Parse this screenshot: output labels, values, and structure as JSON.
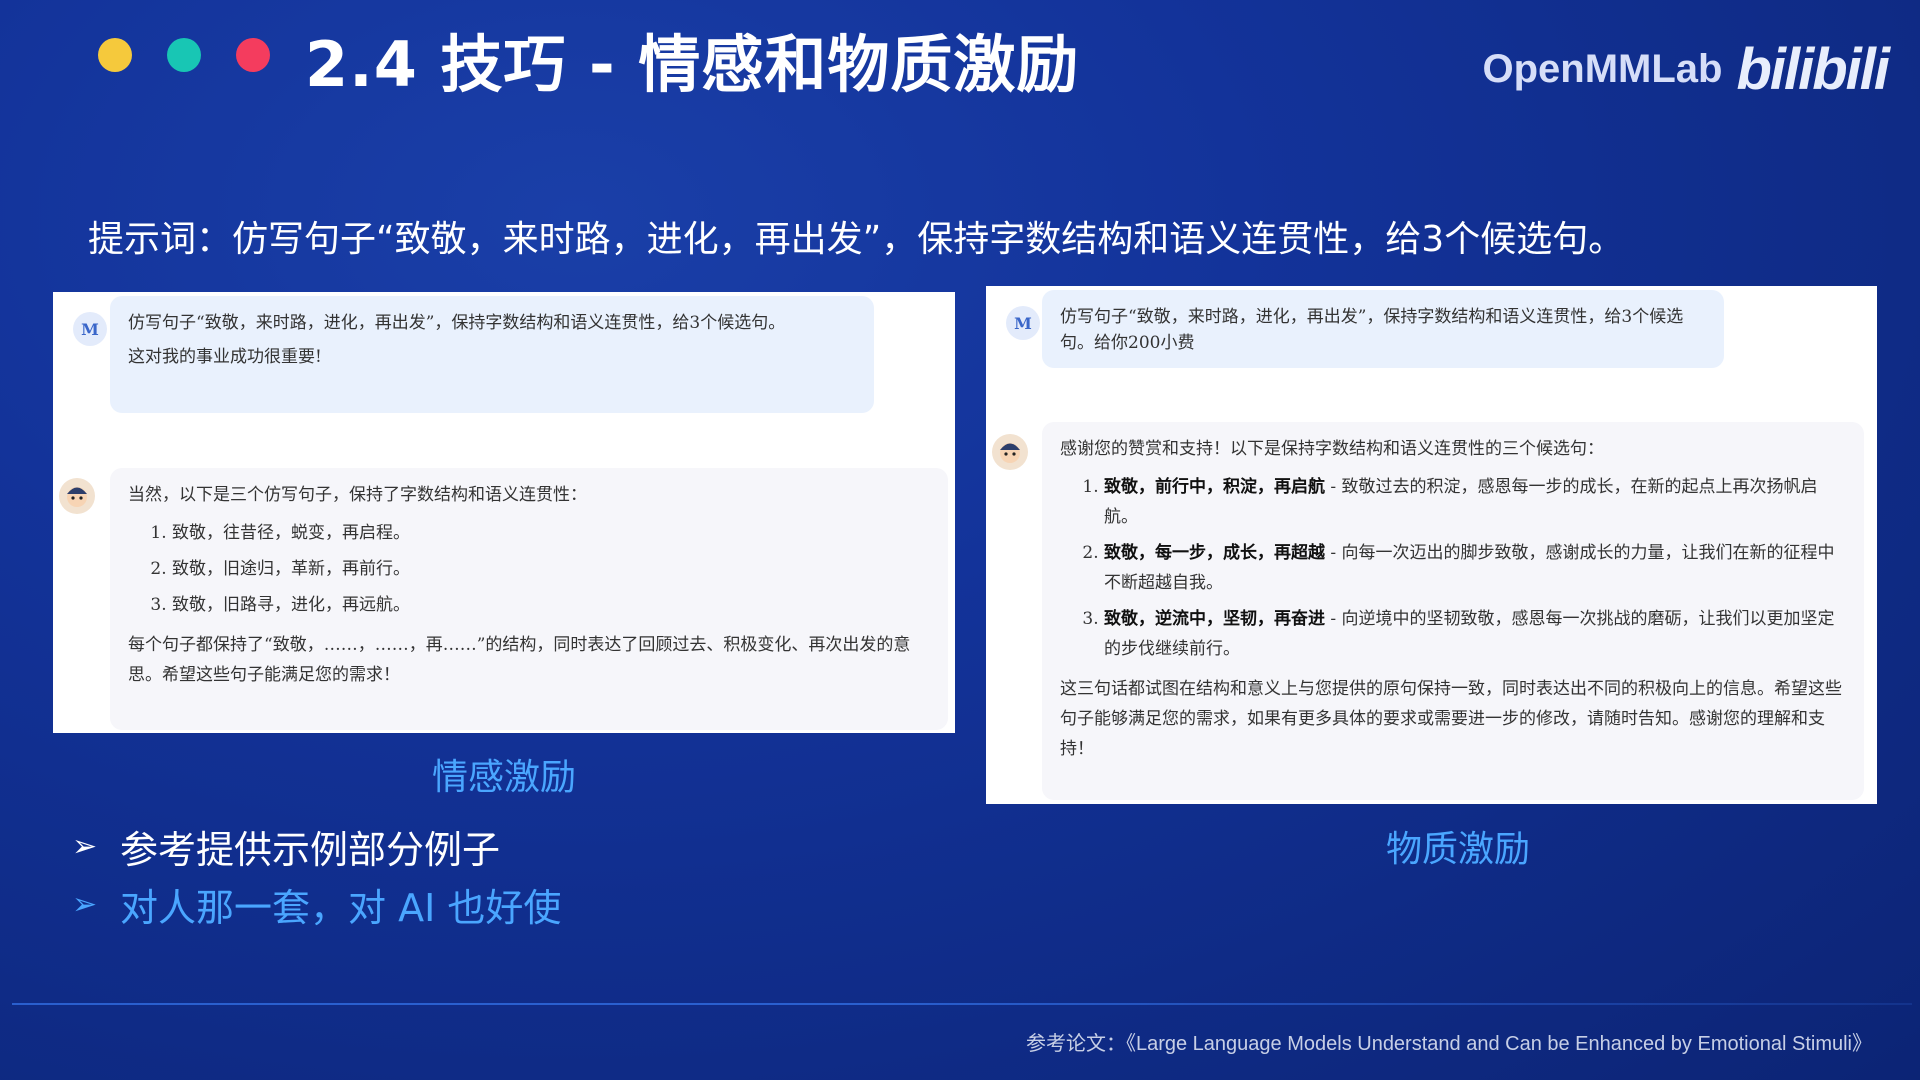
{
  "header": {
    "title": "2.4 技巧 - 情感和物质激励",
    "dot_colors": [
      "#f5c93c",
      "#18c6b4",
      "#f43c5e"
    ],
    "brand_text": "OpenMMLab",
    "brand_logo": "bilibili"
  },
  "prompt": "提示词：仿写句子“致敬，来时路，进化，再出发”，保持字数结构和语义连贯性，给3个候选句。",
  "left_panel": {
    "avatar_user": "M",
    "user_line1": "仿写句子“致敬，来时路，进化，再出发”，保持字数结构和语义连贯性，给3个候选句。",
    "user_line2": "这对我的事业成功很重要!",
    "bot_intro": "当然，以下是三个仿写句子，保持了字数结构和语义连贯性：",
    "items": [
      "致敬，往昔径，蜕变，再启程。",
      "致敬，旧途归，革新，再前行。",
      "致敬，旧路寻，进化，再远航。"
    ],
    "bot_outro": "每个句子都保持了“致敬，……，……，再……”的结构，同时表达了回顾过去、积极变化、再次出发的意思。希望这些句子能满足您的需求！",
    "caption": "情感激励"
  },
  "right_panel": {
    "avatar_user": "M",
    "user_line1": "仿写句子“致敬，来时路，进化，再出发”，保持字数结构和语义连贯性，给3个候选句。给你200小费",
    "bot_intro": "感谢您的赞赏和支持！以下是保持字数结构和语义连贯性的三个候选句：",
    "items": [
      {
        "bold": "致敬，前行中，积淀，再启航",
        "rest": " - 致敬过去的积淀，感恩每一步的成长，在新的起点上再次扬帆启航。"
      },
      {
        "bold": "致敬，每一步，成长，再超越",
        "rest": " - 向每一次迈出的脚步致敬，感谢成长的力量，让我们在新的征程中不断超越自我。"
      },
      {
        "bold": "致敬，逆流中，坚韧，再奋进",
        "rest": " - 向逆境中的坚韧致敬，感恩每一次挑战的磨砺，让我们以更加坚定的步伐继续前行。"
      }
    ],
    "bot_outro": "这三句话都试图在结构和意义上与您提供的原句保持一致，同时表达出不同的积极向上的信息。希望这些句子能够满足您的需求，如果有更多具体的要求或需要进一步的修改，请随时告知。感谢您的理解和支持！",
    "caption": "物质激励"
  },
  "bullets": [
    {
      "text": "参考提供示例部分例子",
      "color": "#ffffff"
    },
    {
      "text": "对人那一套，对 AI 也好使",
      "color": "#4aa6ff"
    }
  ],
  "reference": "参考论文：《Large Language Models Understand and Can be Enhanced by Emotional Stimuli》"
}
